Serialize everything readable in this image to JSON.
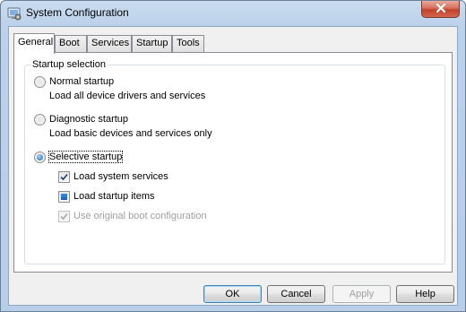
{
  "window": {
    "title": "System Configuration",
    "icon": "msconfig-icon",
    "close_glyph": "×"
  },
  "tabs": [
    {
      "label": "General",
      "active": true
    },
    {
      "label": "Boot",
      "active": false
    },
    {
      "label": "Services",
      "active": false
    },
    {
      "label": "Startup",
      "active": false
    },
    {
      "label": "Tools",
      "active": false
    }
  ],
  "general": {
    "group_title": "Startup selection",
    "normal": {
      "label": "Normal startup",
      "description": "Load all device drivers and services",
      "selected": false
    },
    "diagnostic": {
      "label": "Diagnostic startup",
      "description": "Load basic devices and services only",
      "selected": false
    },
    "selective": {
      "label": "Selective startup",
      "selected": true,
      "options": [
        {
          "label": "Load system services",
          "state": "checked",
          "enabled": true
        },
        {
          "label": "Load startup items",
          "state": "indeterminate",
          "enabled": true
        },
        {
          "label": "Use original boot configuration",
          "state": "checked",
          "enabled": false
        }
      ]
    }
  },
  "buttons": {
    "ok": "OK",
    "cancel": "Cancel",
    "apply": "Apply",
    "help": "Help"
  },
  "colors": {
    "accent": "#1f64b5",
    "close_button": "#c4402a",
    "window_frame": "#b7cde8"
  }
}
